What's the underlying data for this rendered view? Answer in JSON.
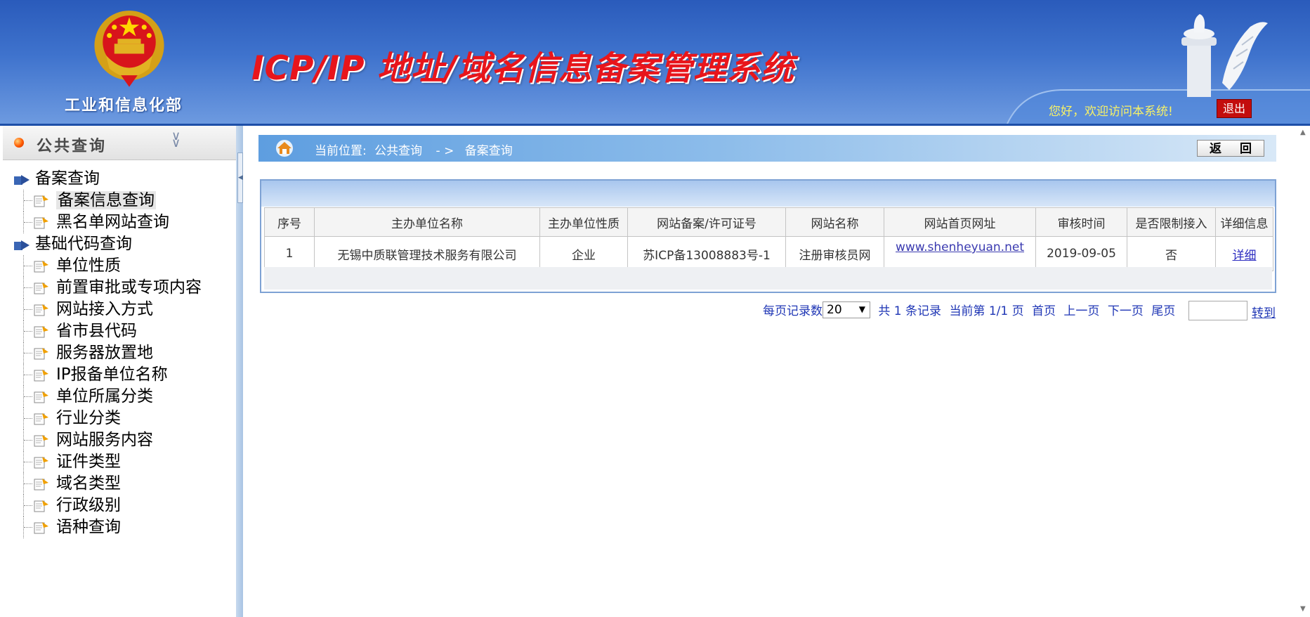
{
  "header": {
    "ministry": "工业和信息化部",
    "system_title": "ICP/IP 地址/域名信息备案管理系统",
    "welcome": "您好，欢迎访问本系统!",
    "logout": "退出"
  },
  "sidebar": {
    "title": "公共查询",
    "tree": [
      {
        "type": "folder",
        "label": "备案查询"
      },
      {
        "type": "leaf",
        "label": "备案信息查询",
        "selected": true
      },
      {
        "type": "leaf",
        "label": "黑名单网站查询"
      },
      {
        "type": "folder",
        "label": "基础代码查询"
      },
      {
        "type": "leaf",
        "label": "单位性质"
      },
      {
        "type": "leaf",
        "label": "前置审批或专项内容"
      },
      {
        "type": "leaf",
        "label": "网站接入方式"
      },
      {
        "type": "leaf",
        "label": "省市县代码"
      },
      {
        "type": "leaf",
        "label": "服务器放置地"
      },
      {
        "type": "leaf",
        "label": "IP报备单位名称"
      },
      {
        "type": "leaf",
        "label": "单位所属分类"
      },
      {
        "type": "leaf",
        "label": "行业分类"
      },
      {
        "type": "leaf",
        "label": "网站服务内容"
      },
      {
        "type": "leaf",
        "label": "证件类型"
      },
      {
        "type": "leaf",
        "label": "域名类型"
      },
      {
        "type": "leaf",
        "label": "行政级别"
      },
      {
        "type": "leaf",
        "label": "语种查询"
      }
    ]
  },
  "breadcrumb": {
    "prefix": "当前位置:",
    "level1": "公共查询",
    "separator": "- >",
    "level2": "备案查询",
    "back": "返 回"
  },
  "table": {
    "columns": [
      "序号",
      "主办单位名称",
      "主办单位性质",
      "网站备案/许可证号",
      "网站名称",
      "网站首页网址",
      "审核时间",
      "是否限制接入",
      "详细信息"
    ],
    "rows": [
      [
        "1",
        "无锡中质联管理技术服务有限公司",
        "企业",
        "苏ICP备13008883号-1",
        "注册审核员网",
        "www.shenheyuan.net",
        "2019-09-05",
        "否",
        "详细"
      ]
    ]
  },
  "pager": {
    "per_page_label": "每页记录数",
    "per_page_value": "20",
    "total": "共 1 条记录",
    "current": "当前第 1/1 页",
    "first": "首页",
    "prev": "上一页",
    "next": "下一页",
    "last": "尾页",
    "goto": "转到"
  },
  "colors": {
    "header_blue": "#3f73cd",
    "title_red": "#e8151b",
    "link_blue": "#1f36b5"
  }
}
